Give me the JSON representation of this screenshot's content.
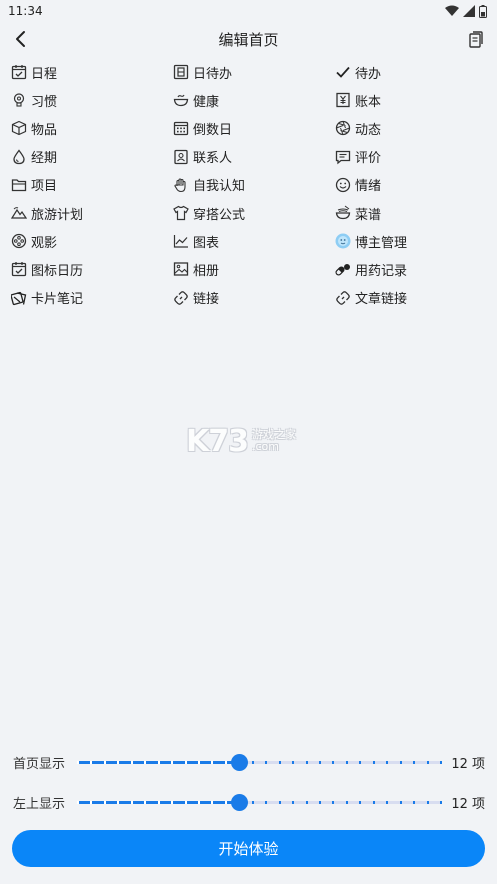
{
  "status_bar": {
    "time": "11:34"
  },
  "header": {
    "title": "编辑首页"
  },
  "items": [
    {
      "label": "日程",
      "icon": "calendar-check-icon"
    },
    {
      "label": "日待办",
      "icon": "daily-todo-icon"
    },
    {
      "label": "待办",
      "icon": "checkmark-icon"
    },
    {
      "label": "习惯",
      "icon": "lightbulb-icon"
    },
    {
      "label": "健康",
      "icon": "bowl-icon"
    },
    {
      "label": "账本",
      "icon": "ledger-icon"
    },
    {
      "label": "物品",
      "icon": "box-icon"
    },
    {
      "label": "倒数日",
      "icon": "calendar-grid-icon"
    },
    {
      "label": "动态",
      "icon": "aperture-icon"
    },
    {
      "label": "经期",
      "icon": "drop-icon"
    },
    {
      "label": "联系人",
      "icon": "contact-card-icon"
    },
    {
      "label": "评价",
      "icon": "comment-icon"
    },
    {
      "label": "项目",
      "icon": "folder-icon"
    },
    {
      "label": "自我认知",
      "icon": "hand-icon"
    },
    {
      "label": "情绪",
      "icon": "smiley-icon"
    },
    {
      "label": "旅游计划",
      "icon": "mountain-icon"
    },
    {
      "label": "穿搭公式",
      "icon": "tshirt-icon"
    },
    {
      "label": "菜谱",
      "icon": "noodle-bowl-icon"
    },
    {
      "label": "观影",
      "icon": "film-reel-icon"
    },
    {
      "label": "图表",
      "icon": "line-chart-icon"
    },
    {
      "label": "博主管理",
      "icon": "blogger-avatar-icon"
    },
    {
      "label": "图标日历",
      "icon": "calendar-check-icon"
    },
    {
      "label": "相册",
      "icon": "image-icon"
    },
    {
      "label": "用药记录",
      "icon": "pill-icon"
    },
    {
      "label": "卡片笔记",
      "icon": "cards-icon"
    },
    {
      "label": "链接",
      "icon": "link-icon"
    },
    {
      "label": "文章链接",
      "icon": "link-icon"
    }
  ],
  "watermark": {
    "big": "K73",
    "line1": "游戏之家",
    "line2": ".com"
  },
  "sliders": [
    {
      "label": "首页显示",
      "count": "12 项",
      "value": 12,
      "min": 0,
      "max": 27
    },
    {
      "label": "左上显示",
      "count": "12 项",
      "value": 12,
      "min": 0,
      "max": 27
    }
  ],
  "start_button": {
    "label": "开始体验"
  },
  "colors": {
    "accent": "#0a86f8",
    "slider": "#1a7be8",
    "background": "#f1f3f6"
  }
}
